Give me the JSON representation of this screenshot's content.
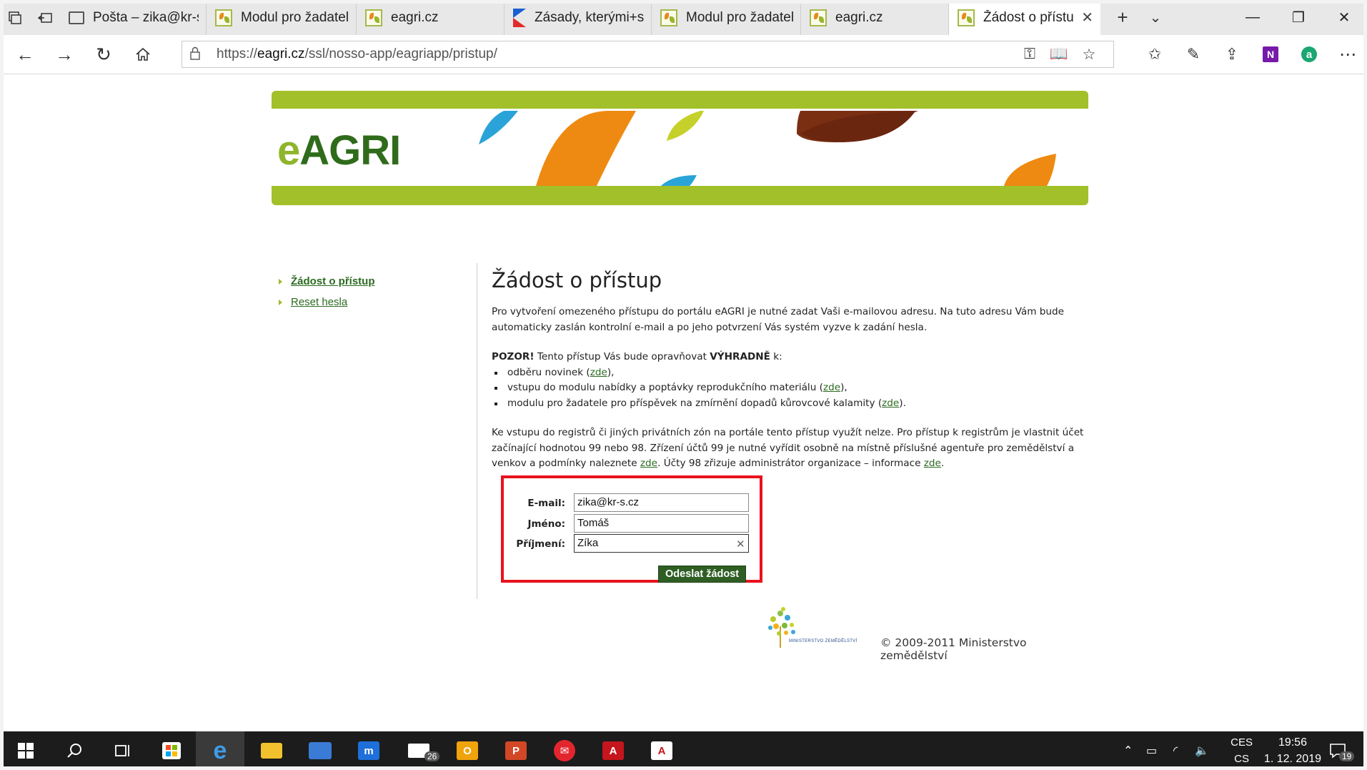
{
  "browser": {
    "tabs": [
      {
        "title": "Pošta – zika@kr-s.c",
        "icon": "mail-icon"
      },
      {
        "title": "Modul pro žadatele",
        "icon": "eagri-favicon"
      },
      {
        "title": "eagri.cz",
        "icon": "eagri-favicon"
      },
      {
        "title": "Zásady, kterými+se",
        "icon": "google-flag-favicon"
      },
      {
        "title": "Modul pro žadatele",
        "icon": "eagri-favicon"
      },
      {
        "title": "eagri.cz",
        "icon": "eagri-favicon"
      },
      {
        "title": "Žádost o přístu",
        "icon": "eagri-favicon",
        "active": true
      }
    ],
    "url_prefix": "https://",
    "url_domain": "eagri.cz",
    "url_path": "/ssl/nosso-app/eagriapp/pristup/"
  },
  "page": {
    "logo_text_e": "e",
    "logo_text_rest": "AGRI",
    "sidebar": [
      {
        "label": "Žádost o přístup",
        "active": true
      },
      {
        "label": "Reset hesla",
        "active": false
      }
    ],
    "title": "Žádost o přístup",
    "intro": "Pro vytvoření omezeného přístupu do portálu eAGRI je nutné zadat Vaši e-mailovou adresu. Na tuto adresu Vám bude automaticky zaslán kontrolní e-mail a po jeho potvrzení Vás systém vyzve k zadání hesla.",
    "warning_bold": "POZOR!",
    "warning_text": " Tento přístup Vás bude opravňovat ",
    "warning_bold2": "VÝHRADNĚ",
    "warning_tail": " k:",
    "bullets": [
      {
        "text": "odběru novinek (",
        "link": "zde",
        "tail": "),"
      },
      {
        "text": "vstupu do modulu nabídky a poptávky reprodukčního materiálu (",
        "link": "zde",
        "tail": "),"
      },
      {
        "text": "modulu pro žadatele pro příspěvek na zmírnění dopadů kůrovcové kalamity (",
        "link": "zde",
        "tail": ")."
      }
    ],
    "registry_text1": "Ke vstupu do registrů či jiných privátních zón na portále tento přístup využít nelze. Pro přístup k registrům je vlastnit účet začínající hodnotou 99 nebo 98. Zřízení účtů 99 je nutné vyřídit osobně na místně příslušné agentuře pro zemědělství a venkov a podmínky naleznete ",
    "registry_link1": "zde",
    "registry_text2": ". Účty 98 zřizuje administrátor organizace – informace ",
    "registry_link2": "zde",
    "registry_text3": ".",
    "form": {
      "email_label": "E-mail:",
      "email_value": "zika@kr-s.cz",
      "name_label": "Jméno:",
      "name_value": "Tomáš",
      "surname_label": "Příjmení:",
      "surname_value": "Zíka",
      "submit_label": "Odeslat žádost"
    },
    "footer": {
      "ministry_small": "MINISTERSTVO ZEMĚDĚLSTVÍ",
      "copyright": "© 2009-2011 Ministerstvo zemědělství"
    }
  },
  "taskbar": {
    "mail_badge": "26",
    "lang_top": "CES",
    "lang_bottom": "CS",
    "time": "19:56",
    "date": "1. 12. 2019",
    "notif_count": "19"
  },
  "colors": {
    "brand_green": "#a2c02a",
    "dark_green": "#2f5e24",
    "highlight_red": "#e8121c"
  }
}
